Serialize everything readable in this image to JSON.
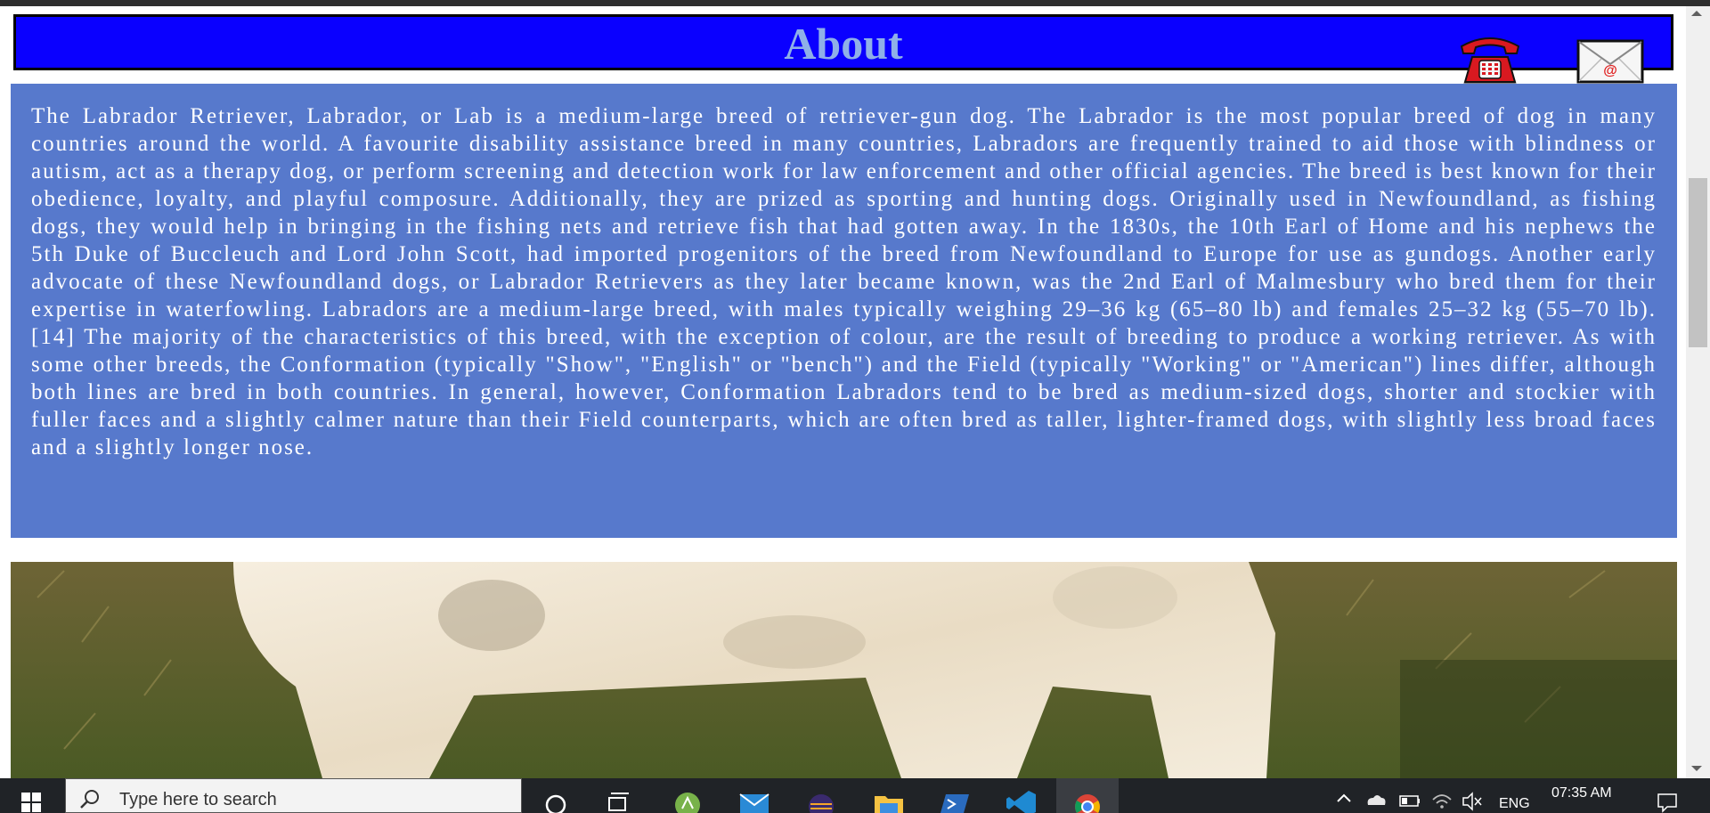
{
  "header": {
    "title": "About",
    "phone_icon": "telephone-icon",
    "mail_icon": "envelope-email-icon"
  },
  "about": {
    "text": "The Labrador Retriever, Labrador, or Lab is a medium-large breed of retriever-gun dog. The Labrador is the most popular breed of dog in many countries around the world. A favourite disability assistance breed in many countries, Labradors are frequently trained to aid those with blindness or autism, act as a therapy dog, or perform screening and detection work for law enforcement and other official agencies. The breed is best known for their obedience, loyalty, and playful composure. Additionally, they are prized as sporting and hunting dogs. Originally used in Newfoundland, as fishing dogs, they would help in bringing in the fishing nets and retrieve fish that had gotten away. In the 1830s, the 10th Earl of Home and his nephews the 5th Duke of Buccleuch and Lord John Scott, had imported progenitors of the breed from Newfoundland to Europe for use as gundogs. Another early advocate of these Newfoundland dogs, or Labrador Retrievers as they later became known, was the 2nd Earl of Malmesbury who bred them for their expertise in waterfowling. Labradors are a medium-large breed, with males typically weighing 29–36 kg (65–80 lb) and females 25–32 kg (55–70 lb).[14] The majority of the characteristics of this breed, with the exception of colour, are the result of breeding to produce a working retriever. As with some other breeds, the Conformation (typically \"Show\", \"English\" or \"bench\") and the Field (typically \"Working\" or \"American\") lines differ, although both lines are bred in both countries. In general, however, Conformation Labradors tend to be bred as medium-sized dogs, shorter and stockier with fuller faces and a slightly calmer nature than their Field counterparts, which are often bred as taller, lighter-framed dogs, with slightly less broad faces and a slightly longer nose."
  },
  "colors": {
    "header_bg": "#0a00ff",
    "header_text": "#8fb0e8",
    "about_bg": "#5779cc",
    "about_text": "#ffffff",
    "taskbar_bg": "#202327"
  },
  "taskbar": {
    "search_placeholder": "Type here to search",
    "apps": [
      "cortana-icon",
      "task-view-icon",
      "android-studio-icon",
      "mail-icon",
      "eclipse-icon",
      "file-explorer-icon",
      "powershell-icon",
      "vscode-icon",
      "chrome-icon"
    ],
    "language": "ENG",
    "time": "07:35 AM"
  }
}
